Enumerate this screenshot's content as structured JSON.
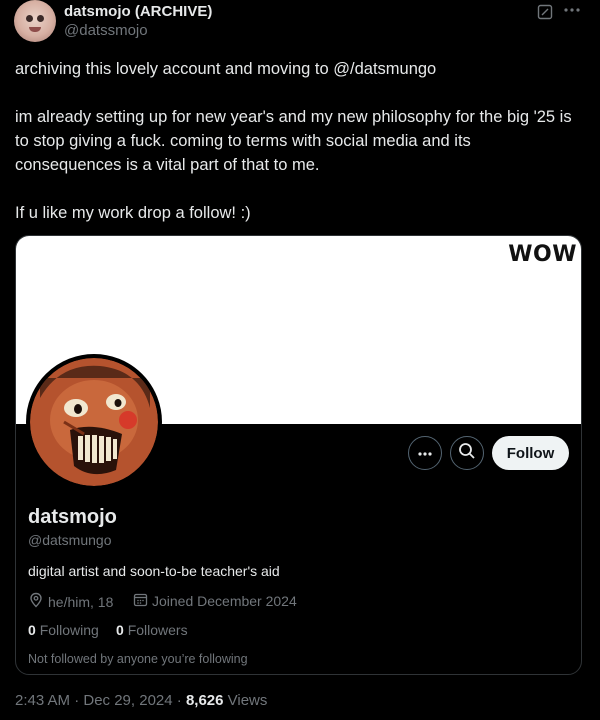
{
  "author": {
    "display_name": "datsmojo (ARCHIVE)",
    "handle": "@datssmojo"
  },
  "icons": {
    "edit": "edit-icon",
    "more": "more-horizontal-icon"
  },
  "post": {
    "paragraphs": [
      "archiving this lovely account and moving to @/datsmungo",
      "im already setting up for new year's and my new philosophy for the big '25 is to stop giving a fuck. coming to terms with social media and its consequences is a vital part of that to me.",
      "If u like my work drop a follow! :)"
    ]
  },
  "card": {
    "banner_text": "WOW",
    "name": "datsmojo",
    "handle": "@datsmungo",
    "bio": "digital artist and soon-to-be teacher's aid",
    "pronouns": "he/him, 18",
    "joined": "Joined December 2024",
    "following_count": "0",
    "following_label": "Following",
    "followers_count": "0",
    "followers_label": "Followers",
    "not_followed": "Not followed by anyone you’re following",
    "follow_label": "Follow"
  },
  "footer": {
    "time": "2:43 AM · Dec 29, 2024 · ",
    "views_count": "8,626",
    "views_label": " Views"
  }
}
